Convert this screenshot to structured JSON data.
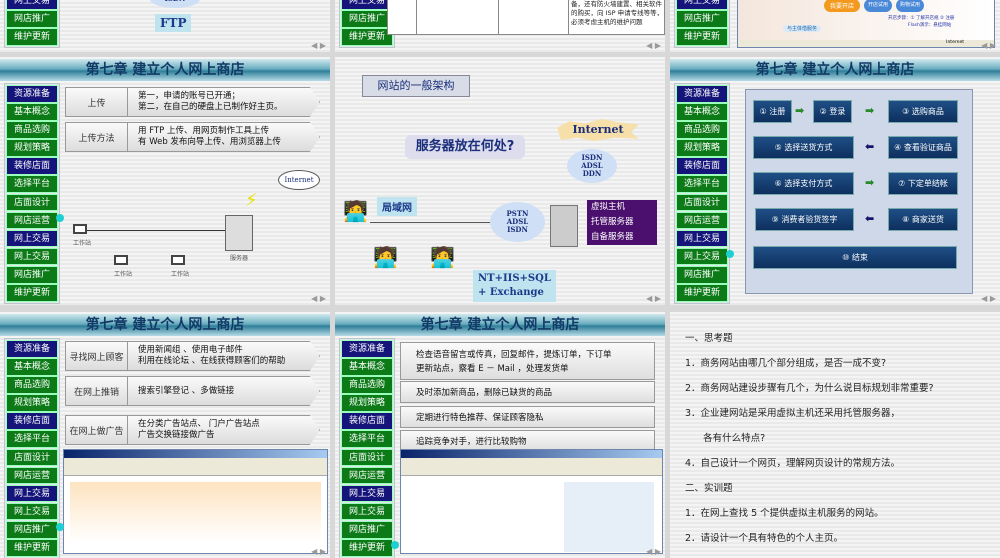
{
  "chapter_title": "第七章  建立个人网上商店",
  "sidebar": [
    "资源准备",
    "基本概念",
    "商品选购",
    "规划策略",
    "装修店面",
    "选择平台",
    "店面设计",
    "网店运营",
    "网上交易",
    "网上交易",
    "网店推广",
    "维护更新"
  ],
  "sidebar_colors": {
    "section": "#14147a",
    "item": "#0d7a18"
  },
  "top_strip": {
    "left": {
      "cloud": "ISDN",
      "ftp": "FTP"
    },
    "middle": {
      "text": [
        "备，还有防火墙建置、相关软件",
        "的购买，向 ISP 申请专线等等，",
        "必须考虑主机的维护问题"
      ]
    },
    "right": {
      "buttons": [
        "我要开店",
        "开店试用",
        "购物试用"
      ],
      "line1": "开店步骤：① 了解开店规 ② 注册",
      "line2": "Flash演示：悬挂网站",
      "banner": "与主体借服务",
      "status": "Internet"
    }
  },
  "upload_slide": {
    "rows": [
      {
        "key": "上传",
        "lines": [
          "第一，申请的账号已开通；",
          "第二，在自己的硬盘上已制作好主页。"
        ]
      },
      {
        "key": "上传方法",
        "lines": [
          "用 FTP 上传、用网页制作工具上传",
          "有 Web 发布向导上传、用浏览器上传"
        ]
      }
    ],
    "internet": "Internet",
    "workstation": "工作站",
    "server": "服务器"
  },
  "arch_slide": {
    "heading": "网站的一般架构",
    "question": "服务器放在何处?",
    "internet": "Internet",
    "cloud1": [
      "ISDN",
      "ADSL",
      "DDN"
    ],
    "cloud2": [
      "PSTN",
      "ADSL",
      "ISDN"
    ],
    "lan": "局域网",
    "hosting": [
      "虚拟主机",
      "托管服务器",
      "自备服务器"
    ],
    "stack": [
      "NT+IIS+SQL",
      "+ Exchange"
    ]
  },
  "flow_slide": {
    "steps": [
      "① 注册",
      "② 登录",
      "③ 选购商品",
      "④ 查看验证商品",
      "⑤ 选择送货方式",
      "⑥ 选择支付方式",
      "⑦ 下定单结帐",
      "⑧ 商家送货",
      "⑨ 消费者验货签字",
      "⑩ 结束"
    ]
  },
  "promo_slide": {
    "rows": [
      {
        "key": "寻找网上顾客",
        "lines": [
          "使用新闻组 、使用电子邮件",
          "利用在线论坛 、在线获得顾客们的帮助"
        ]
      },
      {
        "key": "在网上推销",
        "lines": [
          "搜索引擎登记 、多做链接"
        ]
      },
      {
        "key": "在网上做广告",
        "lines": [
          "在分类广告站点、 门户广告站点",
          "广告交换链接做广告"
        ]
      }
    ]
  },
  "maint_slide": {
    "rows": [
      [
        "检查语音留言或传真，回复邮件，提炼订单，下订单",
        "更新站点，察看 E － Mail ，处理发货单"
      ],
      [
        "及时添加新商品，删除已缺货的商品"
      ],
      [
        "定期进行特色推荐、保证顾客隐私"
      ],
      [
        "追踪竞争对手，进行比较购物"
      ]
    ]
  },
  "exercise_slide": {
    "lines": [
      "一、思考题",
      "1．商务网站由哪几个部分组成，是否一成不变?",
      "2．商务网站建设步骤有几个，为什么说目标规划非常重要?",
      "3．企业建网站是采用虚拟主机还采用托管服务器，",
      "      各有什么特点?",
      "4．自己设计一个网页，理解网页设计的常规方法。",
      "二、实训题",
      "1．在网上查找 5 个提供虚拟主机服务的网站。",
      "2．请设计一个具有特色的个人主页。"
    ]
  }
}
